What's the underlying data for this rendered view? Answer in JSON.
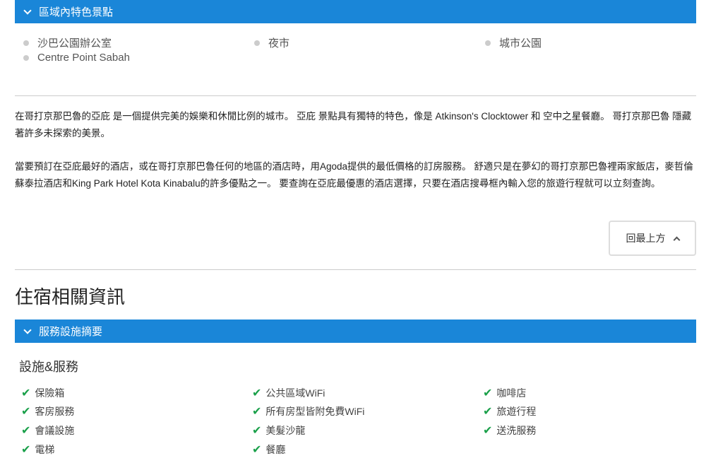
{
  "attractions": {
    "title": "區域內特色景點",
    "items": [
      "沙巴公園辦公室",
      "夜市",
      "城市公園",
      "Centre Point Sabah"
    ]
  },
  "description": {
    "p1": "在哥打京那巴魯的亞庇 是一個提供完美的娛樂和休閒比例的城市。 亞庇 景點具有獨特的特色，像是 Atkinson's Clocktower 和 空中之星餐廳。 哥打京那巴魯 隱藏著許多未探索的美景。",
    "p2": "當要預訂在亞庇最好的酒店，或在哥打京那巴魯任何的地區的酒店時，用Agoda提供的最低價格的訂房服務。 舒適只是在夢幻的哥打京那巴魯裡兩家飯店，麥哲倫蘇泰拉酒店和King Park Hotel Kota Kinabalu的許多優點之一。 要查詢在亞庇最優惠的酒店選擇，只要在酒店搜尋框內輸入您的旅遊行程就可以立刻查詢。"
  },
  "back_to_top": "回最上方",
  "accommodation": {
    "heading": "住宿相關資訊",
    "summary_title": "服務設施摘要",
    "subheading": "設施&服務",
    "columns": [
      [
        "保險箱",
        "客房服務",
        "會議設施",
        "電梯"
      ],
      [
        "公共區域WiFi",
        "所有房型皆附免費WiFi",
        "美髮沙龍",
        "餐廳"
      ],
      [
        "咖啡店",
        "旅遊行程",
        "送洗服務"
      ]
    ]
  },
  "colors": {
    "accent": "#1a86d8",
    "check": "#1aa04a"
  }
}
